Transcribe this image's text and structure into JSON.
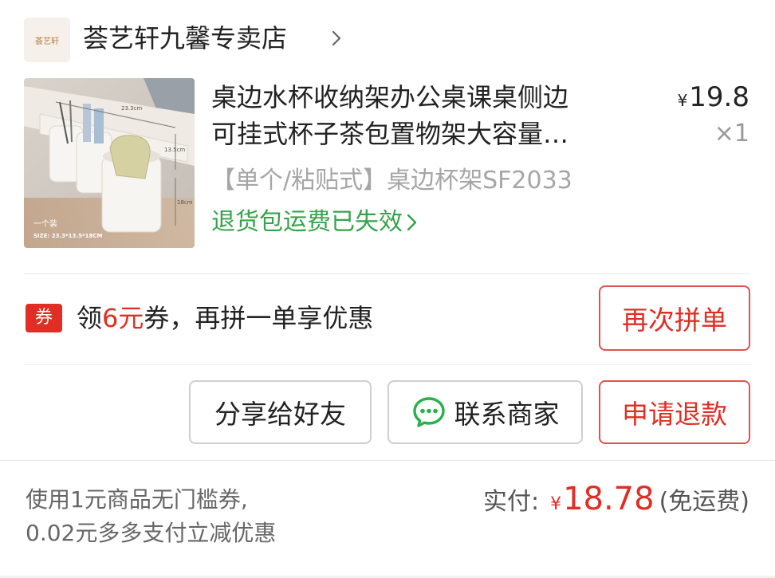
{
  "store": {
    "logo_text": "荟艺轩",
    "name": "荟艺轩九馨专卖店"
  },
  "product": {
    "title_line1": "桌边水杯收纳架办公桌课桌侧边",
    "title_line2": "可挂式杯子茶包置物架大容量…",
    "price_symbol": "¥",
    "price": "19.8",
    "quantity": "×1",
    "spec": "【单个/粘贴式】桌边杯架SF2033",
    "return_status": "退货包运费已失效",
    "image_label_1": "一个装",
    "image_label_2": "SIZE: 23.3*13.5*18CM",
    "image_dim_a": "23.3cm",
    "image_dim_b": "13.5cm",
    "image_dim_c": "18cm"
  },
  "coupon": {
    "badge": "券",
    "text_prefix": "领",
    "amount": "6元",
    "text_suffix": "券，再拼一单享优惠"
  },
  "actions": {
    "reorder": "再次拼单",
    "share": "分享给好友",
    "contact": "联系商家",
    "refund": "申请退款"
  },
  "payment": {
    "discount_line1": "使用1元商品无门槛券,",
    "discount_line2": "0.02元多多支付立减优惠",
    "paid_label": "实付:",
    "paid_symbol": "¥",
    "paid_amount": "18.78",
    "shipping_note": "(免运费)"
  },
  "colors": {
    "accent_red": "#e02e24",
    "return_green": "#35a34b",
    "wechat_green": "#28b14c"
  }
}
